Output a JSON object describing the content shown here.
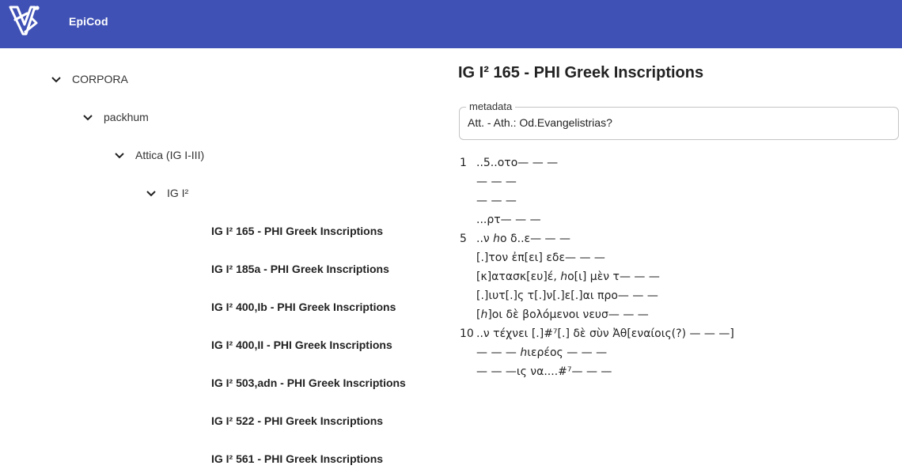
{
  "app": {
    "title": "EpiCod"
  },
  "tree": {
    "root": "CORPORA",
    "corpus": "packhum",
    "region": "Attica (IG I-III)",
    "volume": "IG I²",
    "inscriptions": [
      "IG I² 165 - PHI Greek Inscriptions",
      "IG I² 185a - PHI Greek Inscriptions",
      "IG I² 400,Ib - PHI Greek Inscriptions",
      "IG I² 400,II - PHI Greek Inscriptions",
      "IG I² 503,adn - PHI Greek Inscriptions",
      "IG I² 522 - PHI Greek Inscriptions",
      "IG I² 561 - PHI Greek Inscriptions"
    ]
  },
  "document": {
    "title": "IG I² 165 - PHI Greek Inscriptions",
    "metadata_label": "metadata",
    "metadata_value": "Att. - Ath.: Od.Evangelistrias?",
    "lines": [
      {
        "n": "1",
        "text": "..5..οτο— — —"
      },
      {
        "n": "",
        "text": "— — —"
      },
      {
        "n": "",
        "text": "— — —"
      },
      {
        "n": "",
        "text": "...ρτ— — —"
      },
      {
        "n": "5",
        "text": "..ν ℎο δ..ε— — —"
      },
      {
        "n": "",
        "text": "[.]τον ἐπ[ει] εδε— — —"
      },
      {
        "n": "",
        "text": "[κ]ατασκ[ευ]έ, ℎο[ι] μὲν τ— — —"
      },
      {
        "n": "",
        "text": "[.]ιυτ[.]ς τ[.]ν[.]ε[.]αι προ— — —"
      },
      {
        "n": "",
        "text": "[ℎ]οι δὲ βολόμενοι νευσ— — —"
      },
      {
        "n": "10",
        "text": "..ν τέχνει [.]#⁷[.] δὲ σὺν Ἀθ[εναίοις(?) — — —]"
      },
      {
        "n": "",
        "text": "— — — ℎιερέος — — —"
      },
      {
        "n": "",
        "text": "— — —ις να....#⁷— — —"
      }
    ]
  }
}
